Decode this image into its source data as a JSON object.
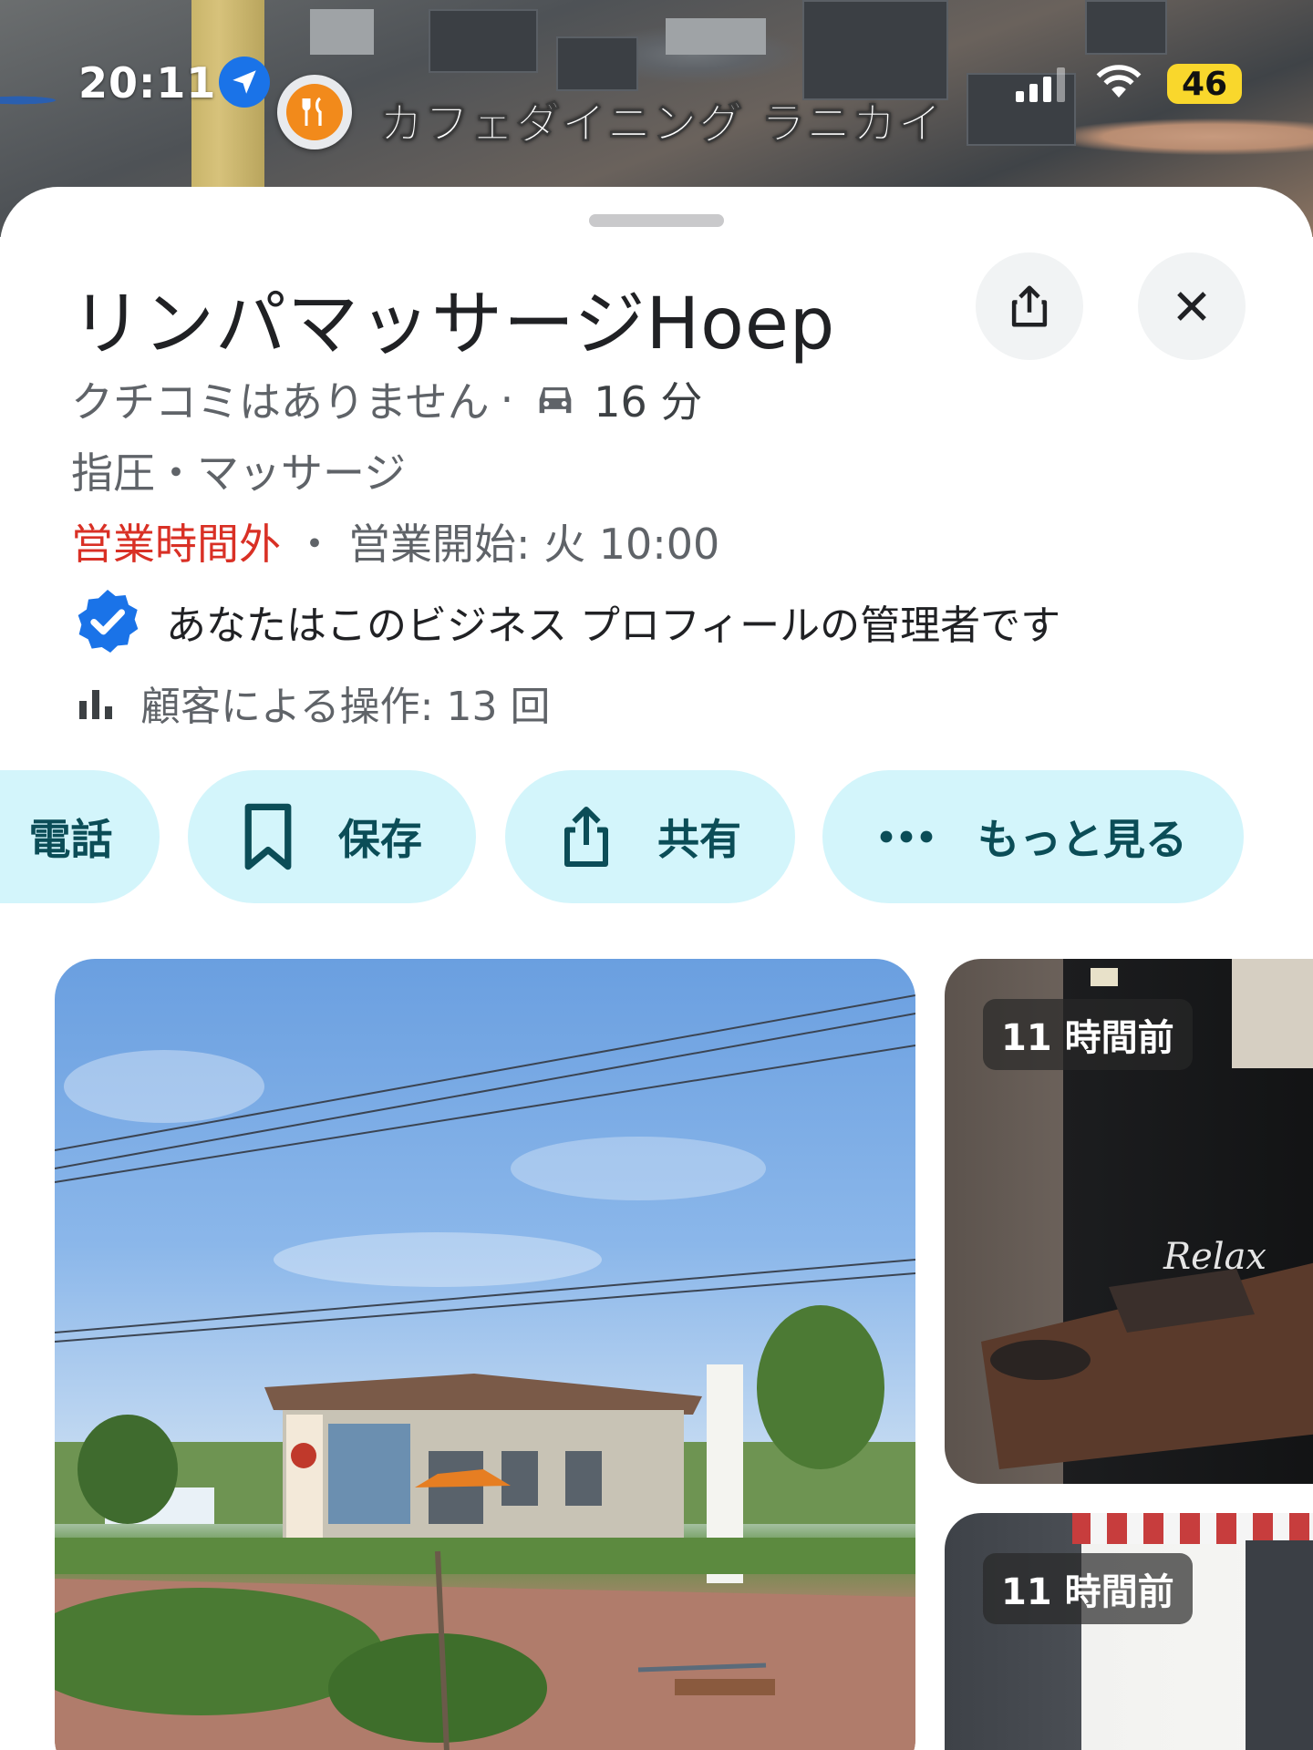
{
  "status_bar": {
    "time": "20:11",
    "battery": "46",
    "location_icon": "location-arrow-icon",
    "signal_icon": "signal-bars-icon",
    "wifi_icon": "wifi-icon"
  },
  "map": {
    "place_label": "カフェダイニング ラニカイ",
    "place_icon": "restaurant-icon",
    "pin_color": "#F28A1B"
  },
  "place": {
    "name": "リンパマッサージHoep",
    "reviews": "クチコミはありません",
    "separator": "·",
    "drive_icon": "car-icon",
    "drive_time": "16 分",
    "category": "指圧・マッサージ",
    "hours_status": "営業時間外",
    "hours_separator": "・",
    "hours_next": "営業開始: 火 10:00",
    "verified_text": "あなたはこのビジネス プロフィールの管理者です",
    "interactions": "顧客による操作: 13 回"
  },
  "actions": {
    "call_label": "電話",
    "save_label": "保存",
    "share_label": "共有",
    "more_label": "もっと見る"
  },
  "photos": {
    "side_top_time": "11 時間前",
    "side_bottom_time": "11 時間前"
  },
  "colors": {
    "chip_background": "#D3F5FB",
    "chip_text": "#0B4D57",
    "closed_red": "#D93025",
    "verified_blue": "#1A73E8"
  }
}
